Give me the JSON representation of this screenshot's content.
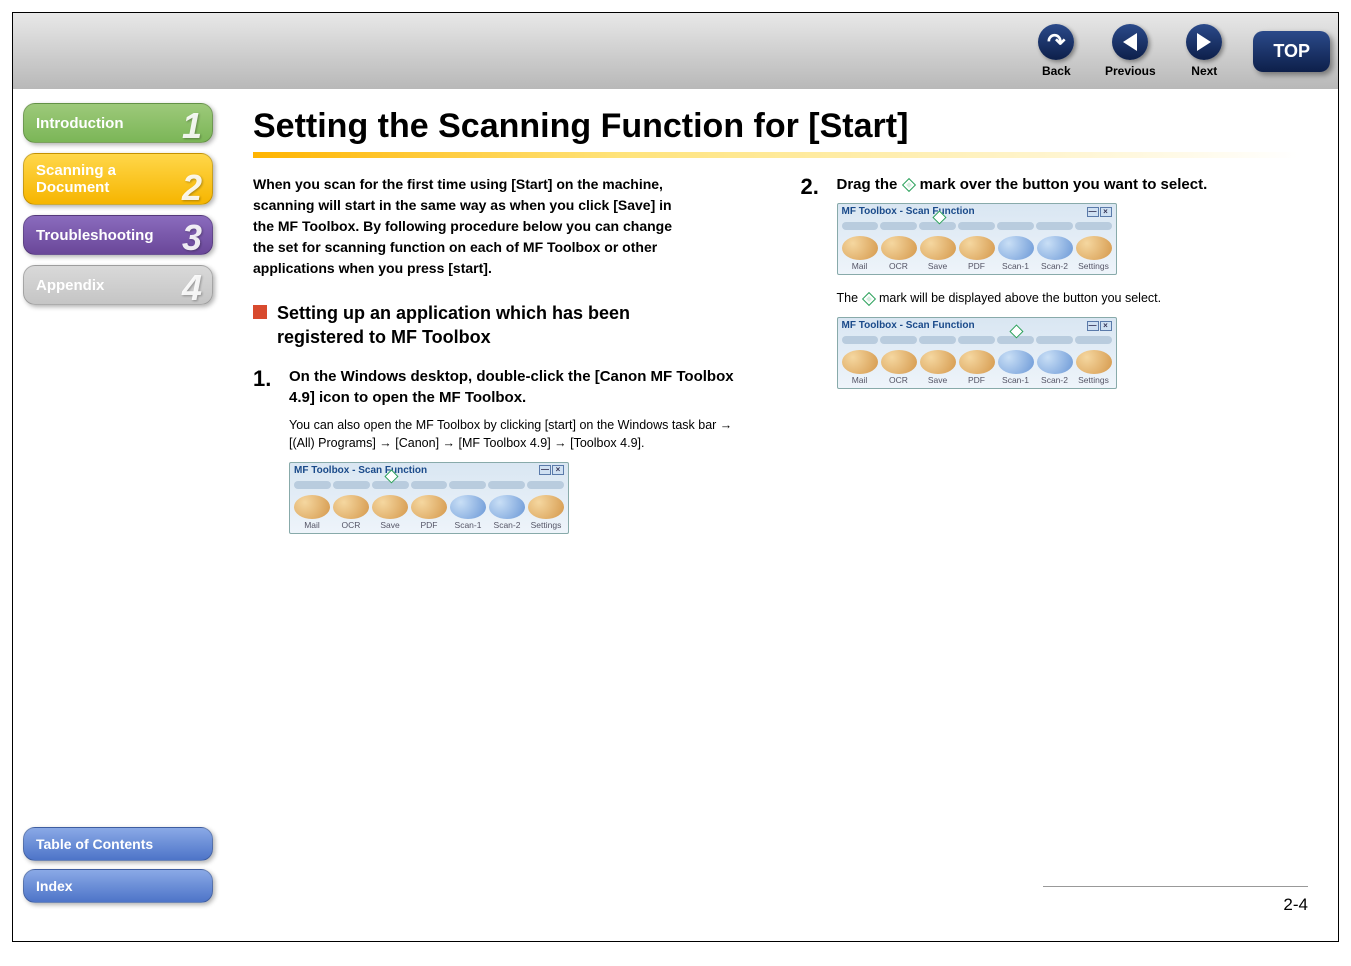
{
  "topnav": {
    "back": "Back",
    "previous": "Previous",
    "next": "Next",
    "top": "TOP"
  },
  "sidebar": {
    "items": [
      {
        "label": "Introduction",
        "num": "1"
      },
      {
        "label": "Scanning a\nDocument",
        "num": "2"
      },
      {
        "label": "Troubleshooting",
        "num": "3"
      },
      {
        "label": "Appendix",
        "num": "4"
      }
    ],
    "toc": "Table of Contents",
    "index": "Index"
  },
  "content": {
    "title": "Setting the Scanning Function for [Start]",
    "intro": "When you scan for the first time using [Start] on the machine, scanning will start in the same way as when you click [Save] in the MF Toolbox. By following procedure below you can change the set for scanning function on each of MF Toolbox or other applications when you press [start].",
    "sub": "Setting up an application which has been registered to MF Toolbox",
    "step1": {
      "num": "1.",
      "title": "On the Windows desktop, double-click the [Canon MF Toolbox 4.9] icon to open the MF Toolbox.",
      "note": "You can also open the MF Toolbox by clicking [start] on the Windows task bar → [(All) Programs] → [Canon] → [MF Toolbox 4.9] → [Toolbox 4.9]."
    },
    "step2": {
      "num": "2.",
      "title_a": "Drag the ",
      "title_b": " mark over the button you want to select.",
      "note_a": "The ",
      "note_b": " mark will be displayed above the button you select."
    },
    "toolbox": {
      "title": "MF Toolbox - Scan Function",
      "labels": [
        "Mail",
        "OCR",
        "Save",
        "PDF",
        "Scan-1",
        "Scan-2",
        "Settings"
      ]
    },
    "pagenum": "2-4"
  }
}
